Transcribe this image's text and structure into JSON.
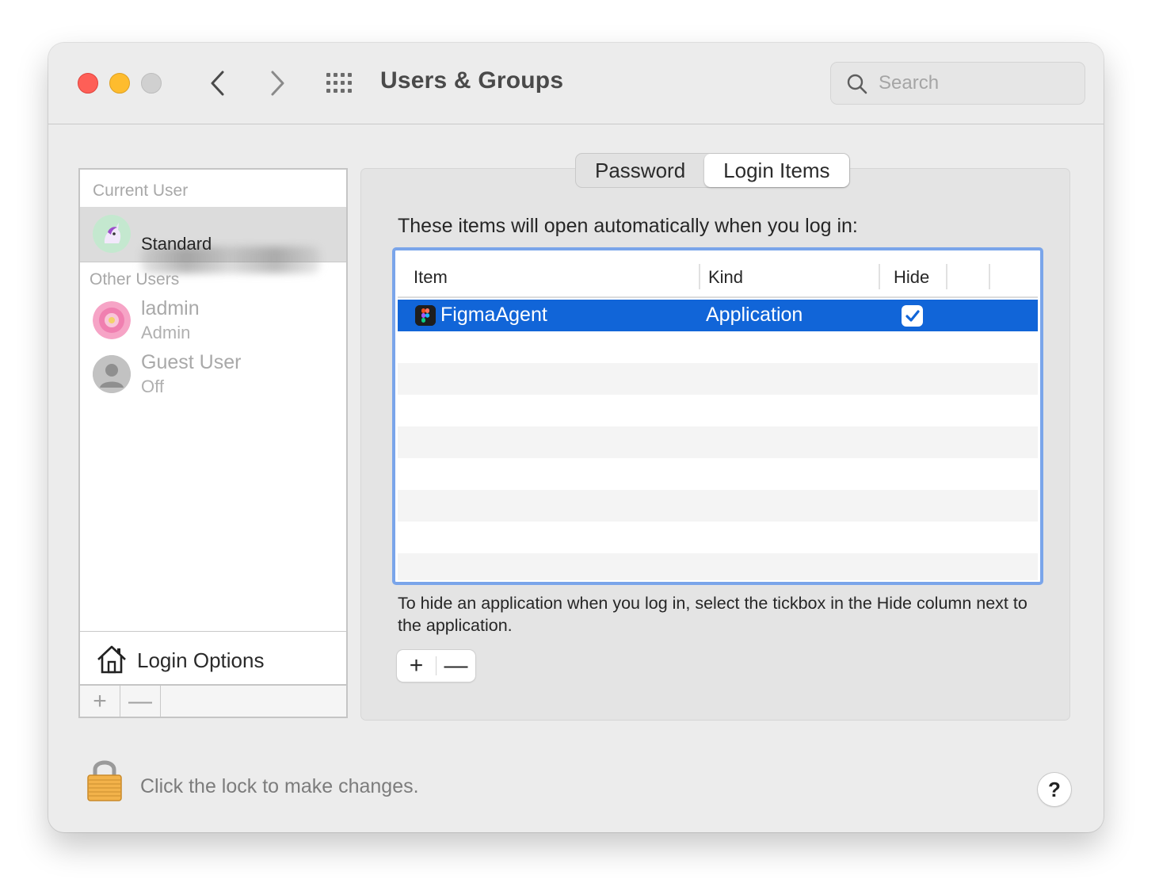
{
  "window": {
    "title": "Users & Groups",
    "search": {
      "placeholder": "Search",
      "value": ""
    }
  },
  "sidebar": {
    "current_section": "Current User",
    "current_user": {
      "name": "",
      "role": "Standard",
      "avatar_icon": "unicorn-avatar-icon"
    },
    "other_section": "Other Users",
    "other_users": [
      {
        "name": "ladmin",
        "role": "Admin",
        "avatar_icon": "flower-avatar-icon"
      },
      {
        "name": "Guest User",
        "role": "Off",
        "avatar_icon": "person-avatar-icon"
      }
    ],
    "login_options": "Login Options",
    "add_label": "+",
    "remove_label": "—"
  },
  "tabs": [
    {
      "label": "Password",
      "active": false
    },
    {
      "label": "Login Items",
      "active": true
    }
  ],
  "login_items": {
    "intro": "These items will open automatically when you log in:",
    "columns": [
      "Item",
      "Kind",
      "Hide"
    ],
    "rows": [
      {
        "item": "FigmaAgent",
        "kind": "Application",
        "hide": true,
        "selected": true,
        "icon": "figma-icon"
      }
    ],
    "hint": "To hide an application when you log in, select the tickbox in the Hide column next to the application.",
    "add_label": "+",
    "remove_label": "—"
  },
  "footer": {
    "lock_text": "Click the lock to make changes.",
    "help_label": "?"
  },
  "colors": {
    "accent": "#1165d8",
    "focus_ring": "#7aa5ea",
    "close": "#fe5f57",
    "minimize": "#febc2e"
  }
}
